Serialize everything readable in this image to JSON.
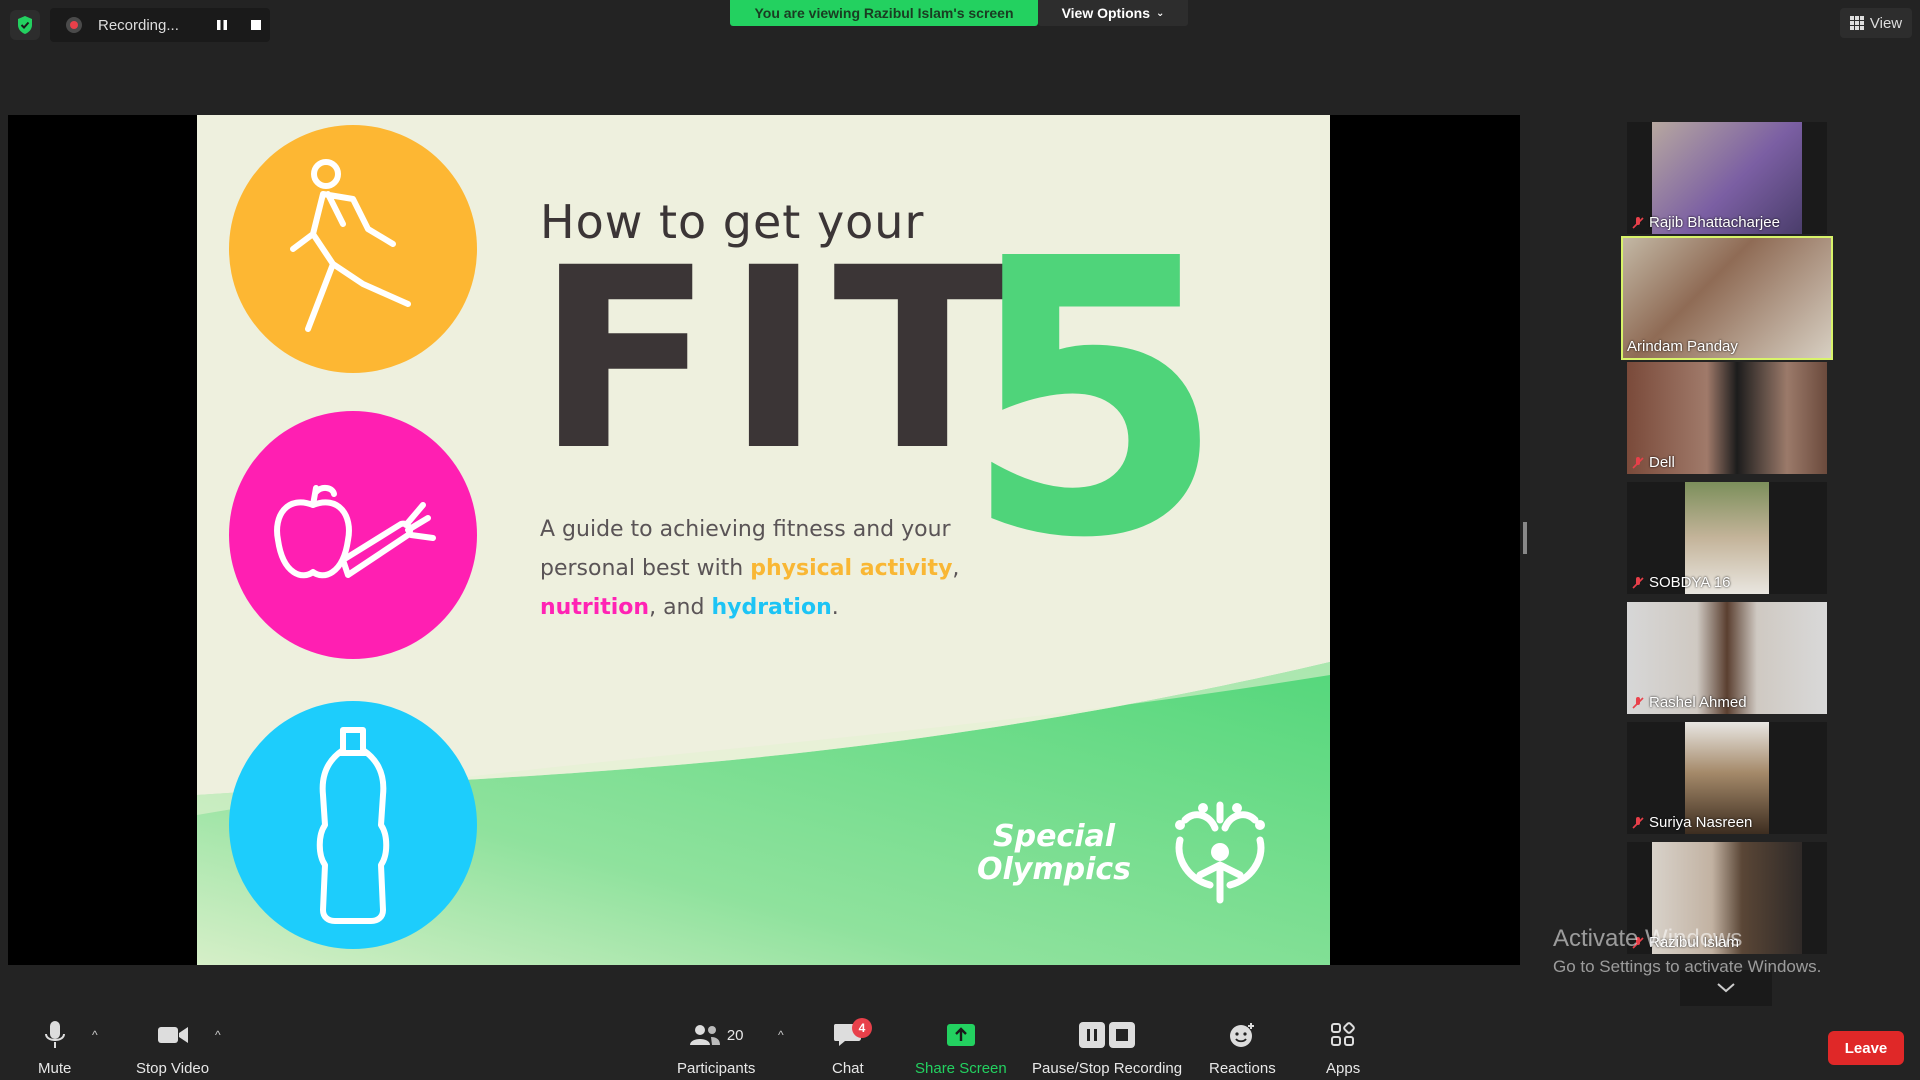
{
  "top": {
    "recording_label": "Recording...",
    "viewing_banner": "You are viewing Razibul Islam's screen",
    "view_options_label": "View Options",
    "view_button_label": "View"
  },
  "slide": {
    "heading": "How to get your",
    "big_word": "FIT",
    "big_number": "5",
    "guide_part1": "A guide to achieving fitness and your personal best with ",
    "guide_physical": "physical activity",
    "guide_sep1": ", ",
    "guide_nutrition": "nutrition",
    "guide_sep2": ", and ",
    "guide_hydration": "hydration",
    "guide_end": ".",
    "brand_line1": "Special",
    "brand_line2": "Olympics",
    "colors": {
      "orange": "#fdb733",
      "pink": "#ff1fb2",
      "blue": "#1dcdfc",
      "green": "#4fd47a",
      "dark": "#3b3536"
    }
  },
  "participants": [
    {
      "name": "Rajib Bhattacharjee",
      "muted": true,
      "active": false
    },
    {
      "name": "Arindam Panday",
      "muted": false,
      "active": true
    },
    {
      "name": "Dell",
      "muted": true,
      "active": false
    },
    {
      "name": "SOBDYA 16",
      "muted": true,
      "active": false
    },
    {
      "name": "Rashel Ahmed",
      "muted": true,
      "active": false
    },
    {
      "name": "Suriya Nasreen",
      "muted": true,
      "active": false
    },
    {
      "name": "Razibul Islam",
      "muted": true,
      "active": false
    }
  ],
  "watermark": {
    "line1": "Activate Windows",
    "line2": "Go to Settings to activate Windows."
  },
  "toolbar": {
    "mute": "Mute",
    "stop_video": "Stop Video",
    "participants": "Participants",
    "participants_count": "20",
    "chat": "Chat",
    "chat_badge": "4",
    "share_screen": "Share Screen",
    "pause_stop_recording": "Pause/Stop Recording",
    "reactions": "Reactions",
    "apps": "Apps",
    "leave": "Leave"
  }
}
